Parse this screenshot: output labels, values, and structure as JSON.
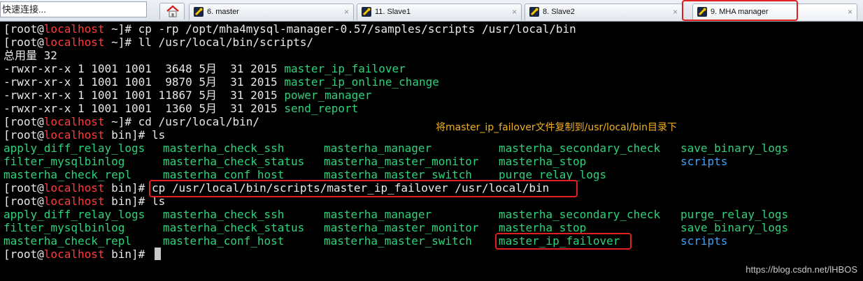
{
  "toolbar": {
    "quick_connect": "快速连接..."
  },
  "tabs": [
    {
      "label": "6. master",
      "close": "×"
    },
    {
      "label": "11. Slave1",
      "close": "×"
    },
    {
      "label": "8. Slave2",
      "close": "×"
    },
    {
      "label": "9. MHA manager",
      "close": "×"
    }
  ],
  "prompt": {
    "pre": "[root@",
    "host": "localhost",
    "home_suffix": " ~]# ",
    "bin_suffix": " bin]# "
  },
  "commands": {
    "cp_samples": "cp -rp /opt/mha4mysql-manager-0.57/samples/scripts /usr/local/bin",
    "ll_scripts": "ll /usr/local/bin/scripts/",
    "cd_bin": "cd /usr/local/bin/",
    "ls1": "ls",
    "cp_failover": "cp /usr/local/bin/scripts/master_ip_failover /usr/local/bin",
    "ls2": "ls"
  },
  "ll_output": {
    "total": "总用量 32",
    "rows": [
      {
        "meta": "-rwxr-xr-x 1 1001 1001  3648 5月  31 2015 ",
        "name": "master_ip_failover"
      },
      {
        "meta": "-rwxr-xr-x 1 1001 1001  9870 5月  31 2015 ",
        "name": "master_ip_online_change"
      },
      {
        "meta": "-rwxr-xr-x 1 1001 1001 11867 5月  31 2015 ",
        "name": "power_manager"
      },
      {
        "meta": "-rwxr-xr-x 1 1001 1001  1360 5月  31 2015 ",
        "name": "send_report"
      }
    ]
  },
  "ls1_output": [
    [
      "apply_diff_relay_logs",
      "masterha_check_ssh",
      "masterha_manager",
      "masterha_secondary_check",
      "save_binary_logs"
    ],
    [
      "filter_mysqlbinlog",
      "masterha_check_status",
      "masterha_master_monitor",
      "masterha_stop",
      "scripts"
    ],
    [
      "masterha_check_repl",
      "masterha_conf_host",
      "masterha_master_switch",
      "purge_relay_logs",
      ""
    ]
  ],
  "ls2_output": [
    [
      "apply_diff_relay_logs",
      "masterha_check_ssh",
      "masterha_manager",
      "masterha_secondary_check",
      "purge_relay_logs"
    ],
    [
      "filter_mysqlbinlog",
      "masterha_check_status",
      "masterha_master_monitor",
      "masterha_stop",
      "save_binary_logs"
    ],
    [
      "masterha_check_repl",
      "masterha_conf_host",
      "masterha_master_switch",
      "master_ip_failover",
      "scripts"
    ]
  ],
  "annotation": "将master_ip_failover文件复制到/usr/local/bin目录下",
  "watermark": "https://blog.csdn.net/lHBOS",
  "colors": {
    "filename": "#2fd27a",
    "directory": "#3aa3ff",
    "host": "#ff3b3b",
    "highlight_box": "#e02020",
    "note": "#f0b020"
  }
}
